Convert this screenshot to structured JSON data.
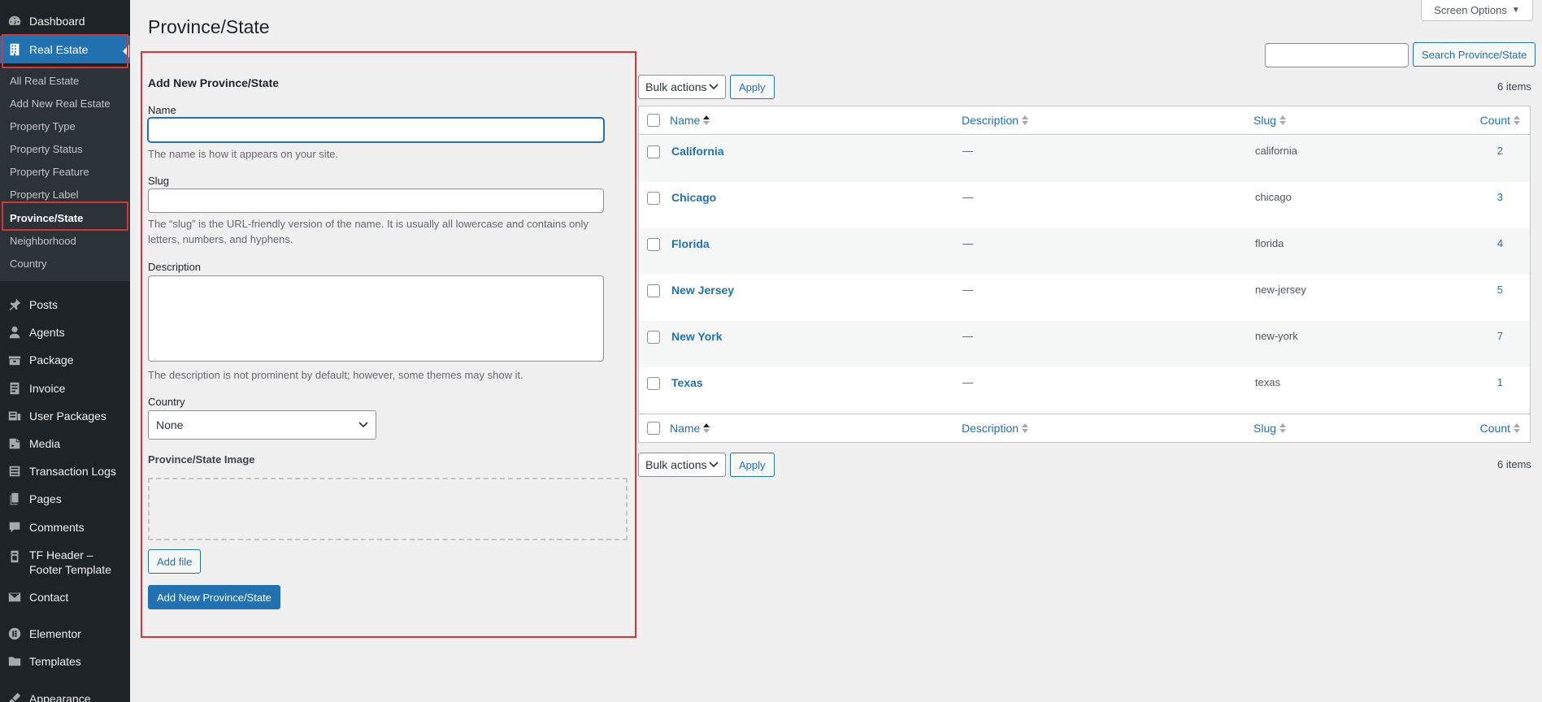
{
  "sidebar": {
    "top_items": [
      {
        "label": "Dashboard",
        "icon": "dashboard-icon"
      },
      {
        "label": "Real Estate",
        "icon": "building-icon"
      }
    ],
    "submenu": [
      {
        "label": "All Real Estate"
      },
      {
        "label": "Add New Real Estate"
      },
      {
        "label": "Property Type"
      },
      {
        "label": "Property Status"
      },
      {
        "label": "Property Feature"
      },
      {
        "label": "Property Label"
      },
      {
        "label": "Province/State"
      },
      {
        "label": "Neighborhood"
      },
      {
        "label": "Country"
      }
    ],
    "items": [
      {
        "label": "Posts",
        "icon": "pushpin-icon"
      },
      {
        "label": "Agents",
        "icon": "user-icon"
      },
      {
        "label": "Package",
        "icon": "package-icon"
      },
      {
        "label": "Invoice",
        "icon": "invoice-icon"
      },
      {
        "label": "User Packages",
        "icon": "user-packages-icon"
      },
      {
        "label": "Media",
        "icon": "media-icon"
      },
      {
        "label": "Transaction Logs",
        "icon": "logs-icon"
      },
      {
        "label": "Pages",
        "icon": "pages-icon"
      },
      {
        "label": "Comments",
        "icon": "comment-icon"
      },
      {
        "label": "TF Header –",
        "label2": "Footer Template",
        "icon": "template-icon"
      },
      {
        "label": "Contact",
        "icon": "mail-icon"
      },
      {
        "label": "Elementor",
        "icon": "elementor-icon"
      },
      {
        "label": "Templates",
        "icon": "folder-icon"
      },
      {
        "label": "Appearance",
        "icon": "brush-icon"
      }
    ]
  },
  "header": {
    "title": "Province/State",
    "screen_options": "Screen Options"
  },
  "form": {
    "heading": "Add New Province/State",
    "name_label": "Name",
    "name_value": "",
    "name_help": "The name is how it appears on your site.",
    "slug_label": "Slug",
    "slug_value": "",
    "slug_help_1": "The “slug” is the URL-friendly version of the name. It is usually all lowercase and contains only",
    "slug_help_2": "letters, numbers, and hyphens.",
    "description_label": "Description",
    "description_help": "The description is not prominent by default; however, some themes may show it.",
    "country_label": "Country",
    "country_value": "None",
    "image_label": "Province/State Image",
    "add_file": "Add file",
    "submit": "Add New Province/State"
  },
  "search": {
    "value": "",
    "button": "Search Province/State"
  },
  "tablenav": {
    "bulk_actions": "Bulk actions",
    "apply": "Apply",
    "items_count": "6 items"
  },
  "table": {
    "columns": {
      "name": "Name",
      "description": "Description",
      "slug": "Slug",
      "count": "Count"
    },
    "rows": [
      {
        "name": "California",
        "description": "—",
        "slug": "california",
        "count": "2"
      },
      {
        "name": "Chicago",
        "description": "—",
        "slug": "chicago",
        "count": "3"
      },
      {
        "name": "Florida",
        "description": "—",
        "slug": "florida",
        "count": "4"
      },
      {
        "name": "New Jersey",
        "description": "—",
        "slug": "new-jersey",
        "count": "5"
      },
      {
        "name": "New York",
        "description": "—",
        "slug": "new-york",
        "count": "7"
      },
      {
        "name": "Texas",
        "description": "—",
        "slug": "texas",
        "count": "1"
      }
    ]
  },
  "colors": {
    "accent": "#2271b1",
    "highlight": "#d63638",
    "sidebar_bg": "#1d2327"
  }
}
